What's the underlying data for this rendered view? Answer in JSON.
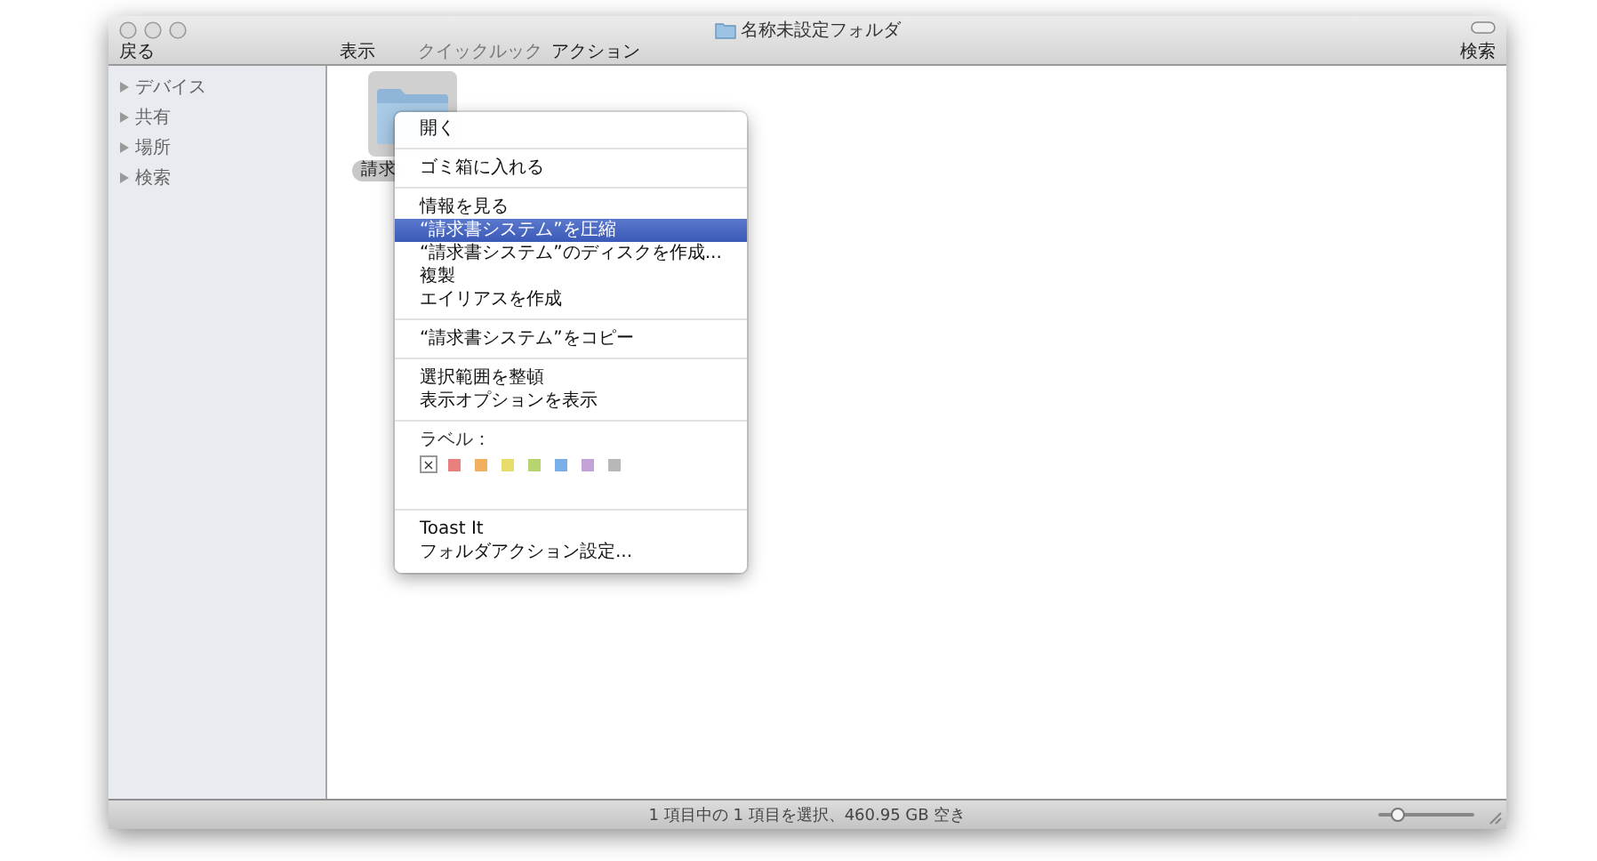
{
  "window": {
    "title": "名称未設定フォルダ"
  },
  "toolbar": {
    "back": "戻る",
    "view": "表示",
    "quicklook": "クイックルック",
    "action": "アクション",
    "search": "検索"
  },
  "sidebar": {
    "items": [
      {
        "label": "デバイス",
        "expanded": false
      },
      {
        "label": "共有",
        "expanded": false
      },
      {
        "label": "場所",
        "expanded": false
      },
      {
        "label": "検索",
        "expanded": false
      }
    ]
  },
  "folder": {
    "label": "請求",
    "selected": true
  },
  "context_menu": {
    "groups": [
      [
        {
          "kind": "item",
          "label": "開く",
          "selected": false
        }
      ],
      [
        {
          "kind": "item",
          "label": "ゴミ箱に入れる",
          "selected": false
        }
      ],
      [
        {
          "kind": "item",
          "label": "情報を見る",
          "selected": false
        },
        {
          "kind": "item",
          "label": "“請求書システム”を圧縮",
          "selected": true
        },
        {
          "kind": "item",
          "label": "“請求書システム”のディスクを作成...",
          "selected": false
        },
        {
          "kind": "item",
          "label": "複製",
          "selected": false
        },
        {
          "kind": "item",
          "label": "エイリアスを作成",
          "selected": false
        }
      ],
      [
        {
          "kind": "item",
          "label": "“請求書システム”をコピー",
          "selected": false
        }
      ],
      [
        {
          "kind": "item",
          "label": "選択範囲を整頓",
          "selected": false
        },
        {
          "kind": "item",
          "label": "表示オプションを表示",
          "selected": false
        }
      ],
      [
        {
          "kind": "heading",
          "label": "ラベル："
        },
        {
          "kind": "swatches",
          "swatches": [
            {
              "kind": "none",
              "text": "×",
              "selected": true
            },
            {
              "kind": "color",
              "color": "#e8817e",
              "selected": false
            },
            {
              "kind": "color",
              "color": "#f0b060",
              "selected": false
            },
            {
              "kind": "color",
              "color": "#e6dc6a",
              "selected": false
            },
            {
              "kind": "color",
              "color": "#b6d56e",
              "selected": false
            },
            {
              "kind": "color",
              "color": "#79aee8",
              "selected": false
            },
            {
              "kind": "color",
              "color": "#c3a3d8",
              "selected": false
            },
            {
              "kind": "color",
              "color": "#b8b8b8",
              "selected": false
            }
          ]
        }
      ],
      [
        {
          "kind": "item",
          "label": "Toast It",
          "selected": false
        },
        {
          "kind": "item",
          "label": "フォルダアクション設定...",
          "selected": false
        }
      ]
    ]
  },
  "status_bar": {
    "text": "1 項目中の 1 項目を選択、460.95 GB 空き",
    "zoom": {
      "level": 0.2
    }
  }
}
